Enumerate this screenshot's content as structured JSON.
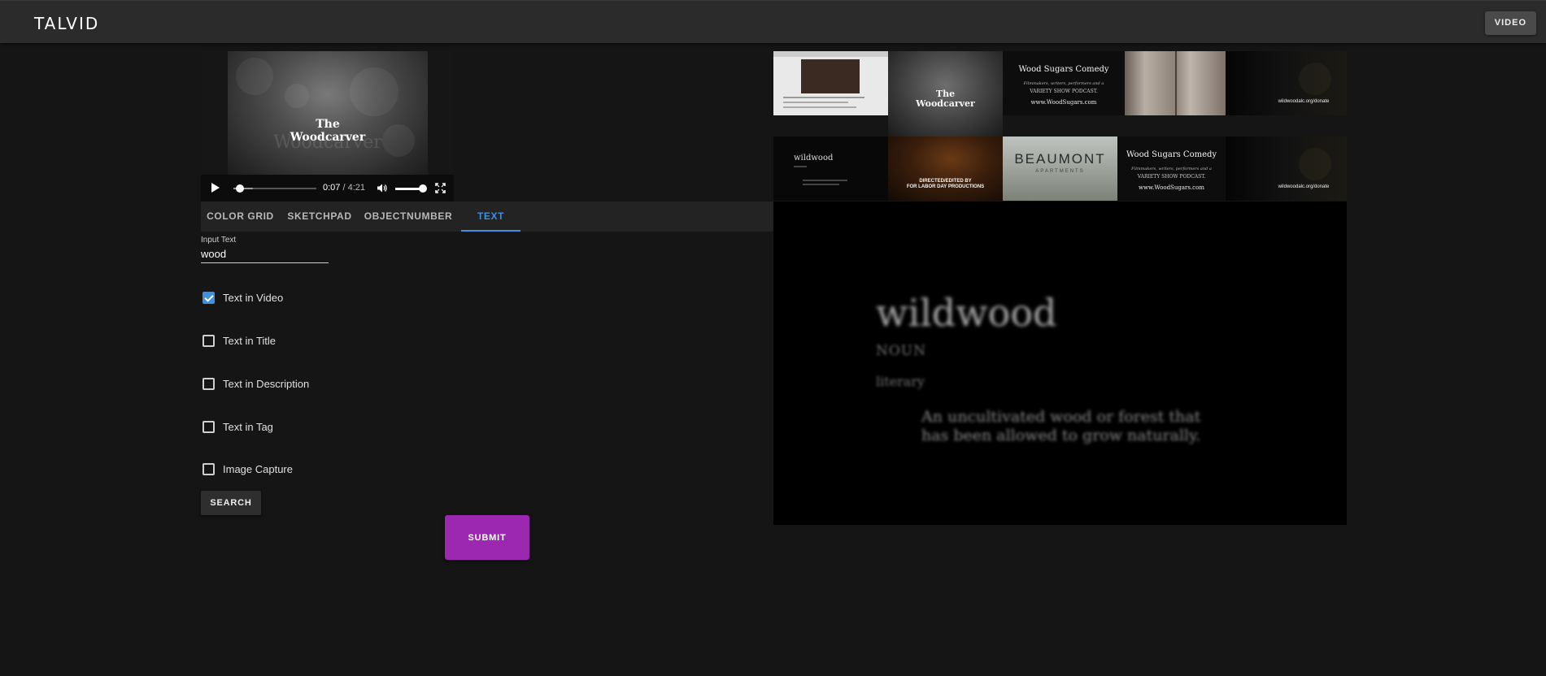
{
  "app": {
    "logo": "TALVID",
    "video_button": "VIDEO"
  },
  "player": {
    "title_line1": "The",
    "title_line2": "Woodcarver",
    "ghost_text": "Woodcarver",
    "current_time": "0:07",
    "separator": " / ",
    "duration": "4:21"
  },
  "tabs": [
    {
      "label": "COLOR GRID"
    },
    {
      "label": "SKETCHPAD"
    },
    {
      "label": "OBJECTNUMBER"
    },
    {
      "label": "TEXT"
    }
  ],
  "form": {
    "input_label": "Input Text",
    "input_value": "wood",
    "checks": [
      {
        "label": "Text in Video",
        "checked": true
      },
      {
        "label": "Text in Title",
        "checked": false
      },
      {
        "label": "Text in Description",
        "checked": false
      },
      {
        "label": "Text in Tag",
        "checked": false
      },
      {
        "label": "Image Capture",
        "checked": false
      }
    ],
    "search_button": "SEARCH",
    "submit_button": "SUBMIT"
  },
  "thumbnails": {
    "woodcarver_line1": "The",
    "woodcarver_line2": "Woodcarver",
    "wood_sugars_title": "Wood Sugars Comedy",
    "wood_sugars_line1": "Filmmakers, writers, performers and a",
    "wood_sugars_line2": "VARIETY SHOW PODCAST.",
    "wood_sugars_url": "www.WoodSugars.com",
    "donate_url": "wildwoodalc.org/donate",
    "wildwood_small": "wildwood",
    "directed_line1": "DIRECTED/EDITED BY",
    "directed_line2": "FOR LABOR DAY PRODUCTIONS",
    "beaumont_title": "BEAUMONT",
    "beaumont_sub": "APARTMENTS"
  },
  "preview": {
    "word": "wildwood",
    "pos": "NOUN",
    "register": "literary",
    "definition": "An uncultivated wood or forest that has been allowed to grow naturally."
  },
  "colors": {
    "accent_blue": "#3d8fe0",
    "submit_purple": "#9c27b0",
    "topbar": "#2b2b2b",
    "background": "#151515"
  }
}
